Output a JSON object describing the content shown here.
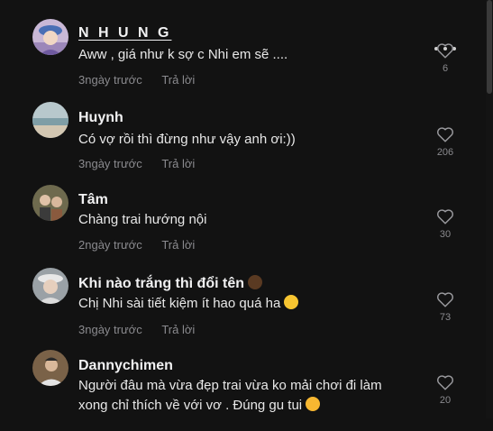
{
  "comments": [
    {
      "author": "N H U N G",
      "text": "Aww , giá như k sợ c Nhi em sẽ ....",
      "time": "3ngày trước",
      "reply": "Trả lời",
      "likes": "6",
      "avatar_icon": "avatar-girl-blue-hat"
    },
    {
      "author": "Huynh",
      "text": "Có vợ rồi thì đừng như vậy anh ơi:))",
      "time": "3ngày trước",
      "reply": "Trả lời",
      "likes": "206",
      "avatar_icon": "avatar-beach-sky"
    },
    {
      "author": "Tâm",
      "text": "Chàng trai hướng nội",
      "time": "2ngày trước",
      "reply": "Trả lời",
      "likes": "30",
      "avatar_icon": "avatar-couple-photo"
    },
    {
      "author": "Khi nào trắng thì đổi tên",
      "author_emoji": "dark-skin-face-emoji",
      "text": "Chị Nhi sài tiết kiệm ít hao quá ha",
      "text_emoji": "grinning-sweat-emoji",
      "time": "3ngày trước",
      "reply": "Trả lời",
      "likes": "73",
      "avatar_icon": "avatar-girl-hat"
    },
    {
      "author": "Dannychimen",
      "text": "Người đâu mà vừa đẹp trai vừa ko mải chơi đi làm",
      "text_line2": "xong chỉ thích về với vơ . Đúng gu tui",
      "text_emoji": "smiling-hearts-emoji",
      "likes": "20",
      "avatar_icon": "avatar-man-photo"
    }
  ],
  "colors": {
    "background": "#121212",
    "author": "#f1f1f2",
    "text": "#e8e8e8",
    "meta": "#8a8a8e"
  },
  "icons": {
    "like": "heart-outline-icon",
    "more": "more-dots-icon"
  }
}
